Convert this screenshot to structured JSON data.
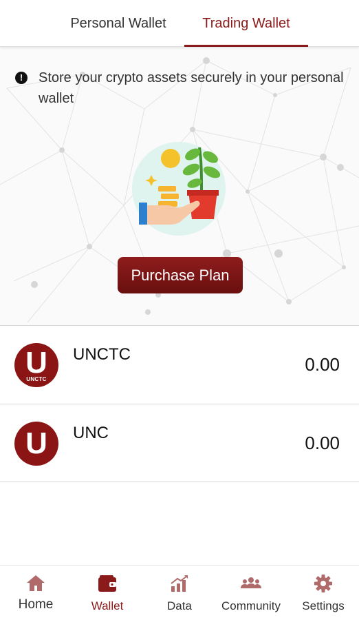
{
  "tabs": {
    "personal": "Personal Wallet",
    "trading": "Trading Wallet",
    "active": "trading"
  },
  "hero": {
    "notice": "Store your crypto assets securely in your personal wallet",
    "notice_icon": "info-icon",
    "illustration": "hand-with-coins-and-plant-icon",
    "button_label": "Purchase Plan"
  },
  "coins": [
    {
      "name": "UNCTC",
      "balance": "0.00",
      "logo_letter": "U",
      "logo_caption": "UNCTC"
    },
    {
      "name": "UNC",
      "balance": "0.00",
      "logo_letter": "U"
    }
  ],
  "nav": [
    {
      "label": "Home",
      "icon": "home-icon"
    },
    {
      "label": "Wallet",
      "icon": "wallet-icon",
      "active": true
    },
    {
      "label": "Data",
      "icon": "chart-icon"
    },
    {
      "label": "Community",
      "icon": "people-icon"
    },
    {
      "label": "Settings",
      "icon": "gear-icon"
    }
  ],
  "colors": {
    "accent": "#8b1a1a",
    "nav_icon": "#b06a6a",
    "coin_logo": "#8b1414"
  }
}
